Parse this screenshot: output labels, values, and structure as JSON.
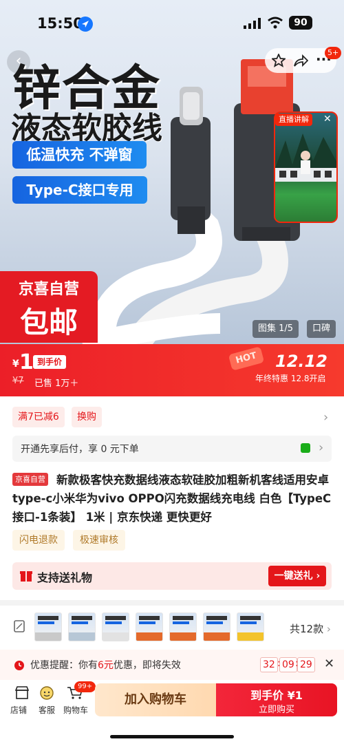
{
  "status_bar": {
    "time": "15:50",
    "battery": "90"
  },
  "header": {
    "message_badge": "5+"
  },
  "hero": {
    "title": "锌合金",
    "subtitle": "液态软胶线",
    "feature_1": "低温快充 不弹窗",
    "feature_2": "Type-C接口专用",
    "promo_line1": "京喜自营",
    "promo_line2": "包邮",
    "live_tag": "直播讲解",
    "gallery_label": "图集 1/5",
    "reviews_label": "口碑"
  },
  "price": {
    "currency": "¥",
    "value": "1",
    "tag": "到手价",
    "original": "¥7",
    "sold": "已售 1万＋",
    "hot": "HOT",
    "event_date": "12.12",
    "event_sub": "年终特惠 12.8开启"
  },
  "promotions": {
    "discount": "满7已减6",
    "swap": "换购"
  },
  "payment": {
    "text": "开通先享后付，享 0 元下单"
  },
  "product": {
    "badge": "京喜自营",
    "title": "新款极客快充数据线液态软硅胶加粗新机客线适用安卓type-c小米华为vivo OPPO闪充数据线充电线 白色【TypeC接口-1条装】 1米 | 京东快递 更快更好"
  },
  "services": {
    "refund": "闪电退款",
    "review": "极速审核"
  },
  "gift": {
    "text": "支持送礼物",
    "button": "一键送礼"
  },
  "variants": {
    "total": "共12款",
    "thumb_colors": [
      "#c9c9c9",
      "#b7c7d6",
      "#e2e2e2",
      "#e46a2b",
      "#e46a2b",
      "#e46a2b",
      "#f3c32b"
    ]
  },
  "reminder": {
    "prefix": "优惠提醒：你有",
    "amount": "6元",
    "suffix": "优惠，即将失效",
    "hours": "32",
    "minutes": "09",
    "seconds": "29"
  },
  "bottom_bar": {
    "store": "店铺",
    "service": "客服",
    "cart": "购物车",
    "cart_badge": "99+",
    "add_to_cart": "加入购物车",
    "buy_line1": "到手价 ¥1",
    "buy_line2": "立即购买"
  }
}
